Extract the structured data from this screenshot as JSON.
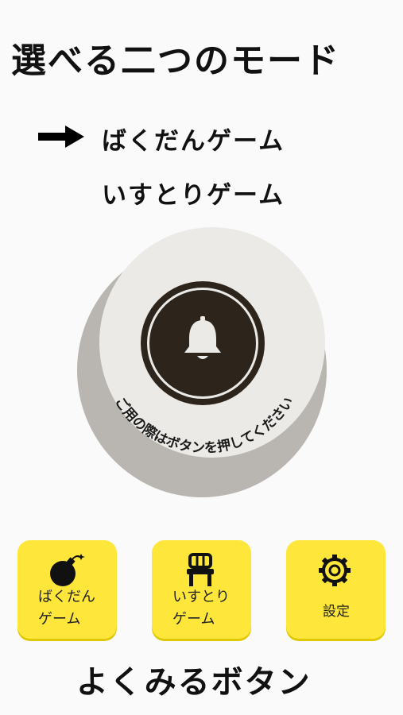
{
  "title": "選べる二つのモード",
  "menu": {
    "items": [
      {
        "label": "ばくだんゲーム",
        "selected": true
      },
      {
        "label": "いすとりゲーム",
        "selected": false
      }
    ],
    "cursor_icon": "arrow-right-icon"
  },
  "bell_button": {
    "caption": "ご用の際はボタンを押してください",
    "icon": "bell-icon"
  },
  "tiles": [
    {
      "line1": "ばくだん",
      "line2": "ゲーム",
      "icon": "bomb-icon"
    },
    {
      "line1": "いすとり",
      "line2": "ゲーム",
      "icon": "chair-icon"
    },
    {
      "line1": "設定",
      "icon": "gear-icon"
    }
  ],
  "footer": "よくみるボタン",
  "colors": {
    "tile": "#ffe63a",
    "button_dark": "#2d241c",
    "face": "#ebeae7",
    "shadow": "#b9b5b0"
  }
}
